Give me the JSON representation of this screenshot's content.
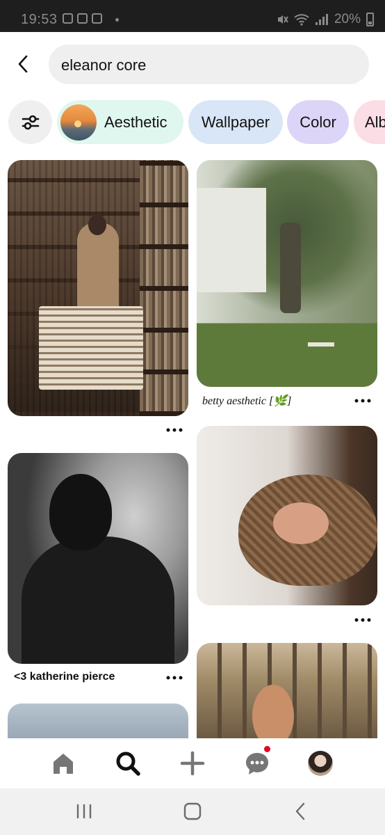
{
  "status_bar": {
    "time": "19:53",
    "battery": "20%",
    "icons": [
      "image-icon",
      "gmail-icon",
      "butterfly-icon",
      "dot-icon",
      "mute-icon",
      "wifi-icon",
      "signal-icon",
      "battery-icon"
    ]
  },
  "search": {
    "query": "eleanor core",
    "back_icon": "chevron-left-icon"
  },
  "chips": {
    "filter_icon": "sliders-icon",
    "items": [
      {
        "label": "Aesthetic",
        "color": "#dff7ee"
      },
      {
        "label": "Wallpaper",
        "color": "#d8e6f7"
      },
      {
        "label": "Color",
        "color": "#ddd5f8"
      },
      {
        "label": "Alb",
        "color": "#fbdde5"
      }
    ]
  },
  "feed": {
    "pins": [
      {
        "title": "",
        "image": "bookshop-woman-reading"
      },
      {
        "title": "betty aesthetic [🌿]",
        "image": "tree-swing-house"
      },
      {
        "title": "<3 katherine pierce",
        "image": "bw-woman-silhouette"
      },
      {
        "title": "",
        "image": "flower-basket"
      },
      {
        "title": "",
        "image": "forest-girl"
      },
      {
        "title": "",
        "image": "sky"
      }
    ],
    "more_icon": "more-dots-icon"
  },
  "bottom_nav": {
    "items": [
      "home-icon",
      "search-icon",
      "plus-icon",
      "messages-icon",
      "profile-avatar"
    ],
    "active": "search-icon",
    "notification_color": "#e60023"
  },
  "system_nav": {
    "items": [
      "recents-icon",
      "home-button-icon",
      "back-icon"
    ]
  }
}
